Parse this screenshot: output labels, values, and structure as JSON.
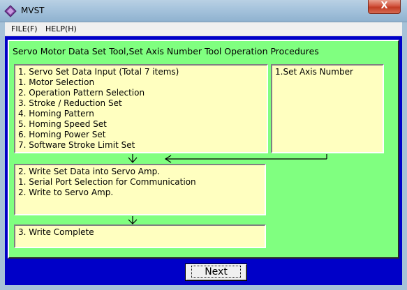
{
  "window": {
    "title": "MVST",
    "close_label": "X"
  },
  "menu": [
    {
      "label": "FILE(F)"
    },
    {
      "label": "HELP(H)"
    }
  ],
  "main": {
    "heading": "Servo Motor Data Set Tool,Set Axis Number Tool Operation Procedures",
    "step1": {
      "title": "1. Servo Set Data Input (Total 7 items)",
      "items": [
        "1. Motor Selection",
        "2. Operation Pattern Selection",
        "3. Stroke / Reduction Set",
        "4. Homing Pattern",
        "5. Homing Speed Set",
        "6. Homing Power Set",
        "7. Software Stroke Limit Set"
      ]
    },
    "axis": {
      "title": "1.Set Axis Number"
    },
    "step2": {
      "title": "2. Write Set Data into Servo Amp.",
      "items": [
        "1. Serial Port Selection for Communication",
        "2. Write to Servo Amp."
      ]
    },
    "step3": {
      "title": "3. Write Complete"
    }
  },
  "footer": {
    "next_label": "Next"
  },
  "colors": {
    "panel": "#80ff80",
    "box": "#ffffc0",
    "client": "#0000c8"
  }
}
